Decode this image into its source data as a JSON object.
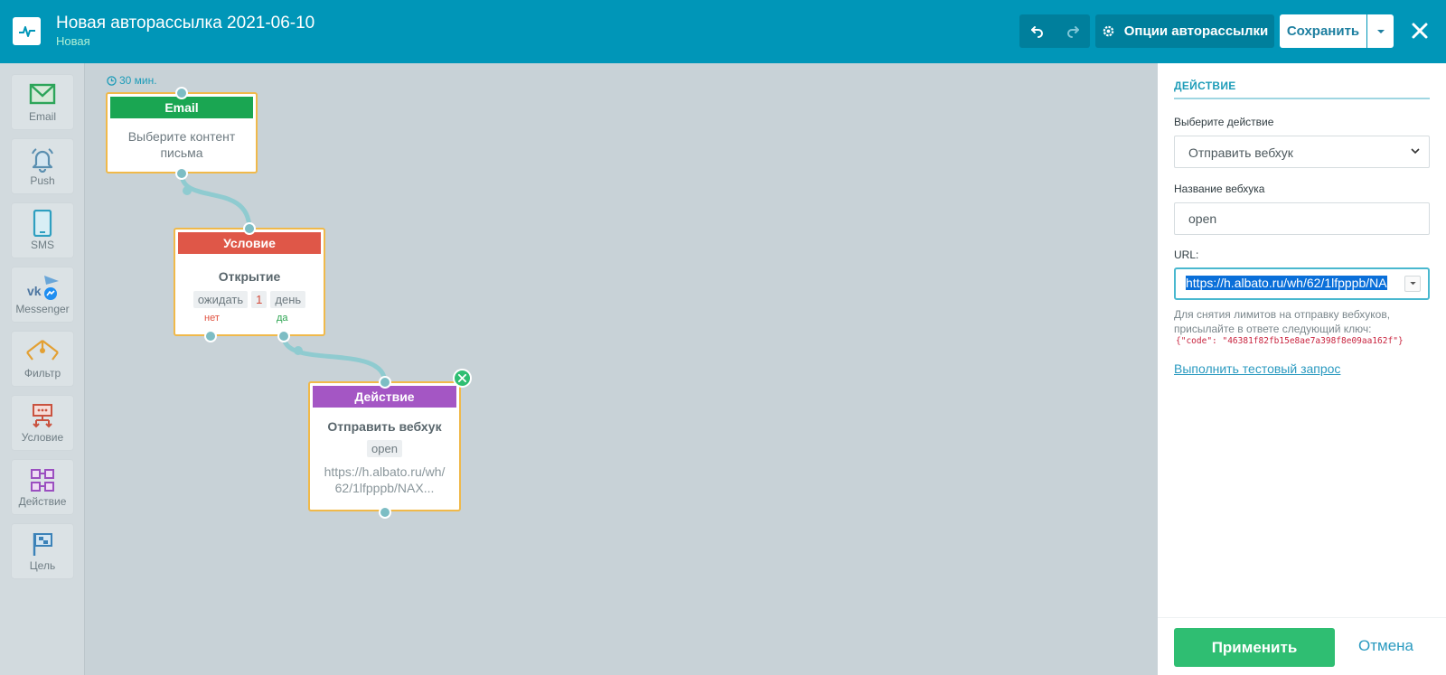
{
  "header": {
    "title": "Новая авторассылка 2021-06-10",
    "status": "Новая",
    "options_label": "Опции авторассылки",
    "save_label": "Сохранить",
    "brand_color": "#0096b8"
  },
  "sidebar": {
    "tools": [
      {
        "label": "Email",
        "icon": "envelope-icon"
      },
      {
        "label": "Push",
        "icon": "bell-icon"
      },
      {
        "label": "SMS",
        "icon": "phone-icon"
      },
      {
        "label": "Messenger",
        "icon": "messenger-icon"
      },
      {
        "label": "Фильтр",
        "icon": "filter-icon"
      },
      {
        "label": "Условие",
        "icon": "condition-icon"
      },
      {
        "label": "Действие",
        "icon": "action-icon"
      },
      {
        "label": "Цель",
        "icon": "flag-icon"
      }
    ]
  },
  "canvas": {
    "delay": "30 мин.",
    "email_node": {
      "title": "Email",
      "body": "Выберите контент письма"
    },
    "condition_node": {
      "title": "Условие",
      "subtitle": "Открытие",
      "wait_label": "ожидать",
      "wait_value": "1",
      "wait_unit": "день",
      "no_label": "нет",
      "yes_label": "да"
    },
    "action_node": {
      "title": "Действие",
      "subtitle": "Отправить вебхук",
      "name_chip": "open",
      "url": "https://h.albato.ru/wh/62/1lfpppb/NAX..."
    }
  },
  "panel": {
    "title": "ДЕЙСТВИЕ",
    "action_label": "Выберите действие",
    "action_value": "Отправить вебхук",
    "name_label": "Название вебхука",
    "name_value": "open",
    "url_label": "URL:",
    "url_value": "https://h.albato.ru/wh/62/1lfpppb/NA",
    "hint": "Для снятия лимитов на отправку вебхуков, присылайте в ответе следующий ключ:",
    "code": "{\"code\": \"46381f82fb15e8ae7a398f8e09aa162f\"}",
    "test_link": "Выполнить тестовый запрос",
    "apply_label": "Применить",
    "cancel_label": "Отмена"
  }
}
